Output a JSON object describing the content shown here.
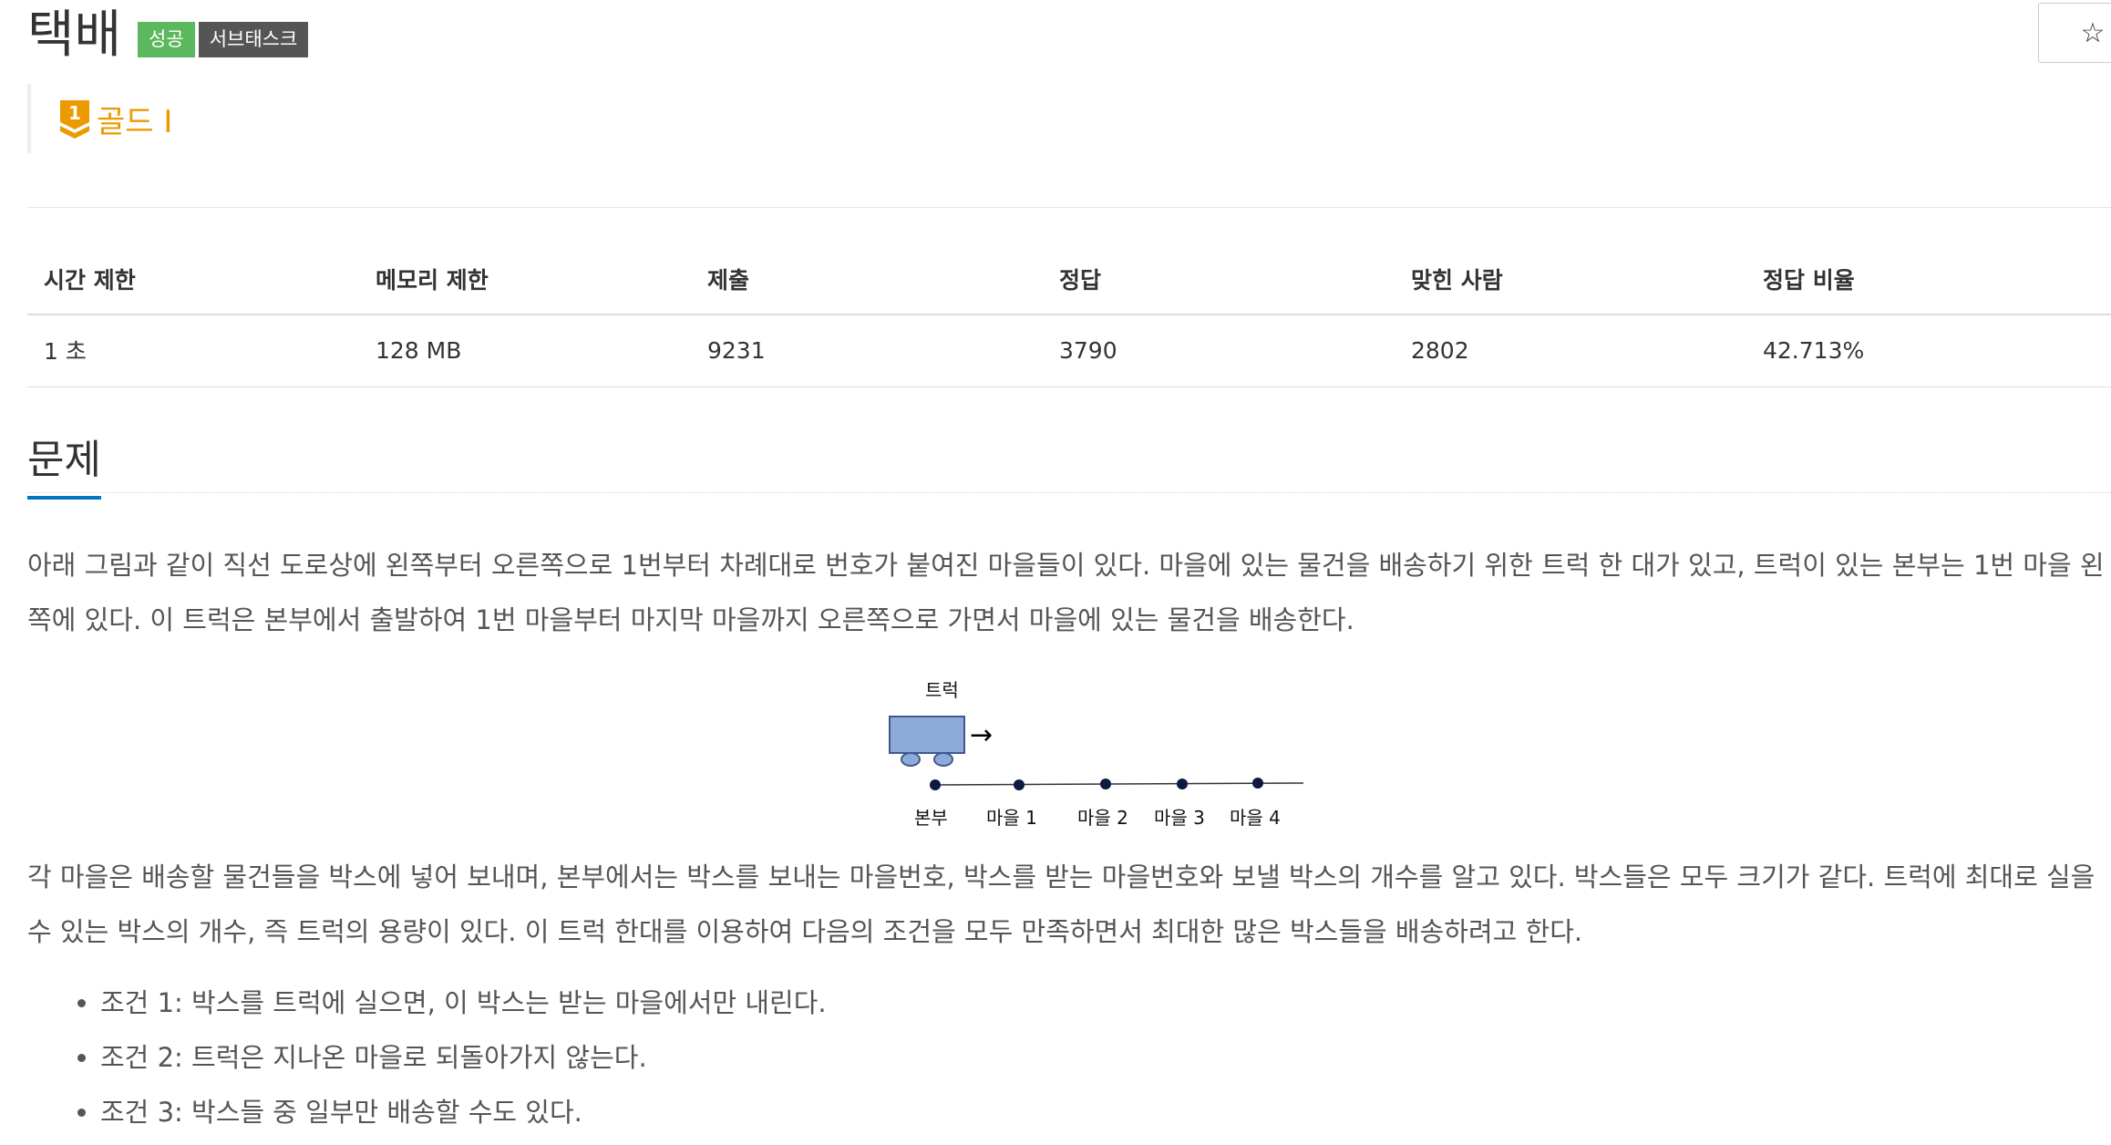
{
  "header": {
    "title": "택배",
    "labels": [
      "성공",
      "서브태스크"
    ],
    "star_icon": "star-icon",
    "star_glyph": "☆"
  },
  "tier": {
    "icon": "tier-gold-1-icon",
    "icon_number": "1",
    "text": "골드 I",
    "color": "#ec9a00"
  },
  "info_table": {
    "headers": [
      "시간 제한",
      "메모리 제한",
      "제출",
      "정답",
      "맞힌 사람",
      "정답 비율"
    ],
    "values": [
      "1 초",
      "128 MB",
      "9231",
      "3790",
      "2802",
      "42.713%"
    ]
  },
  "section": {
    "title": "문제",
    "accent_color": "#0076c0"
  },
  "description": {
    "paragraph1": "아래 그림과 같이 직선 도로상에 왼쪽부터 오른쪽으로 1번부터 차례대로 번호가 붙여진 마을들이 있다. 마을에 있는 물건을 배송하기 위한 트럭 한 대가 있고, 트럭이 있는 본부는 1번 마을 왼쪽에 있다. 이 트럭은 본부에서 출발하여 1번 마을부터 마지막 마을까지 오른쪽으로 가면서 마을에 있는 물건을 배송한다.",
    "paragraph2": "각 마을은 배송할 물건들을 박스에 넣어 보내며, 본부에서는 박스를 보내는 마을번호, 박스를 받는 마을번호와 보낼 박스의 개수를 알고 있다. 박스들은 모두 크기가 같다. 트럭에 최대로 실을 수 있는 박스의 개수, 즉 트럭의 용량이 있다. 이 트럭 한대를 이용하여 다음의 조건을 모두 만족하면서 최대한 많은 박스들을 배송하려고 한다.",
    "conditions": [
      "조건 1: 박스를 트럭에 실으면, 이 박스는 받는 마을에서만 내린다.",
      "조건 2: 트럭은 지나온 마을로 되돌아가지 않는다.",
      "조건 3: 박스들 중 일부만 배송할 수도 있다."
    ]
  },
  "diagram": {
    "truck_label": "트럭",
    "arrow": "→",
    "stops": [
      "본부",
      "마을 1",
      "마을 2",
      "마을 3",
      "마을 4"
    ],
    "truck_color": "#8eaadb"
  }
}
